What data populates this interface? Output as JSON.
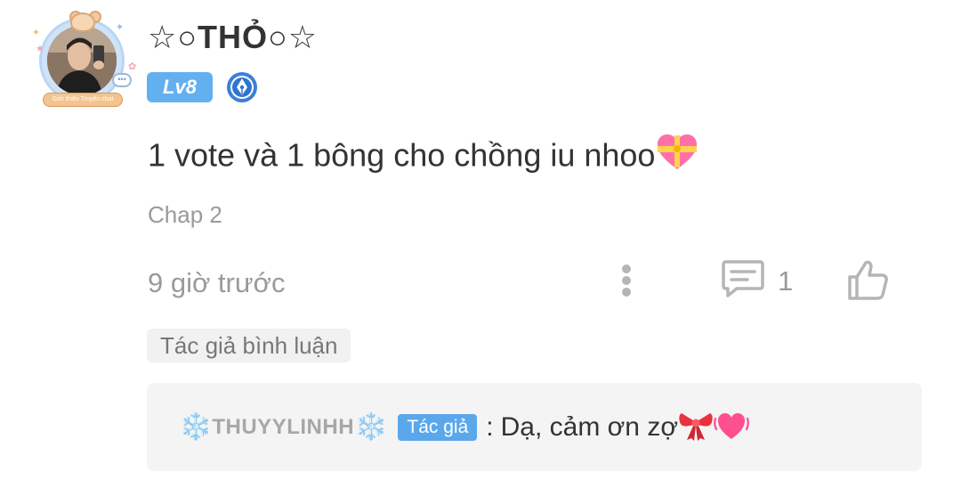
{
  "comment": {
    "username": "☆○THỎ○☆",
    "level": "Lv8",
    "avatar_banner": "Giới thiệu Truyện chat",
    "text": "1 vote và 1 bông cho chồng iu nhoo",
    "chapter": "Chap 2",
    "time": "9 giờ trước",
    "reply_count": "1"
  },
  "author_reply": {
    "section_label": "Tác giả bình luận",
    "author_name": "THUYYLINHH",
    "snowflake": "❄️",
    "author_tag": "Tác giả",
    "separator": ":",
    "text": "Dạ, cảm ơn zợ"
  },
  "icons": {
    "more": "more-vertical-icon",
    "reply": "comment-icon",
    "like": "thumbs-up-icon",
    "badge": "pen-badge-icon",
    "emoji_heart": "gift-heart-emoji",
    "emoji_ribbon": "ribbon-emoji",
    "emoji_vibrating_heart": "vibrating-heart-emoji"
  },
  "colors": {
    "accent_blue": "#5aa7ec",
    "level_blue": "#63b0f0",
    "muted_text": "#9a9a9a",
    "reply_bg": "#f4f4f4"
  }
}
